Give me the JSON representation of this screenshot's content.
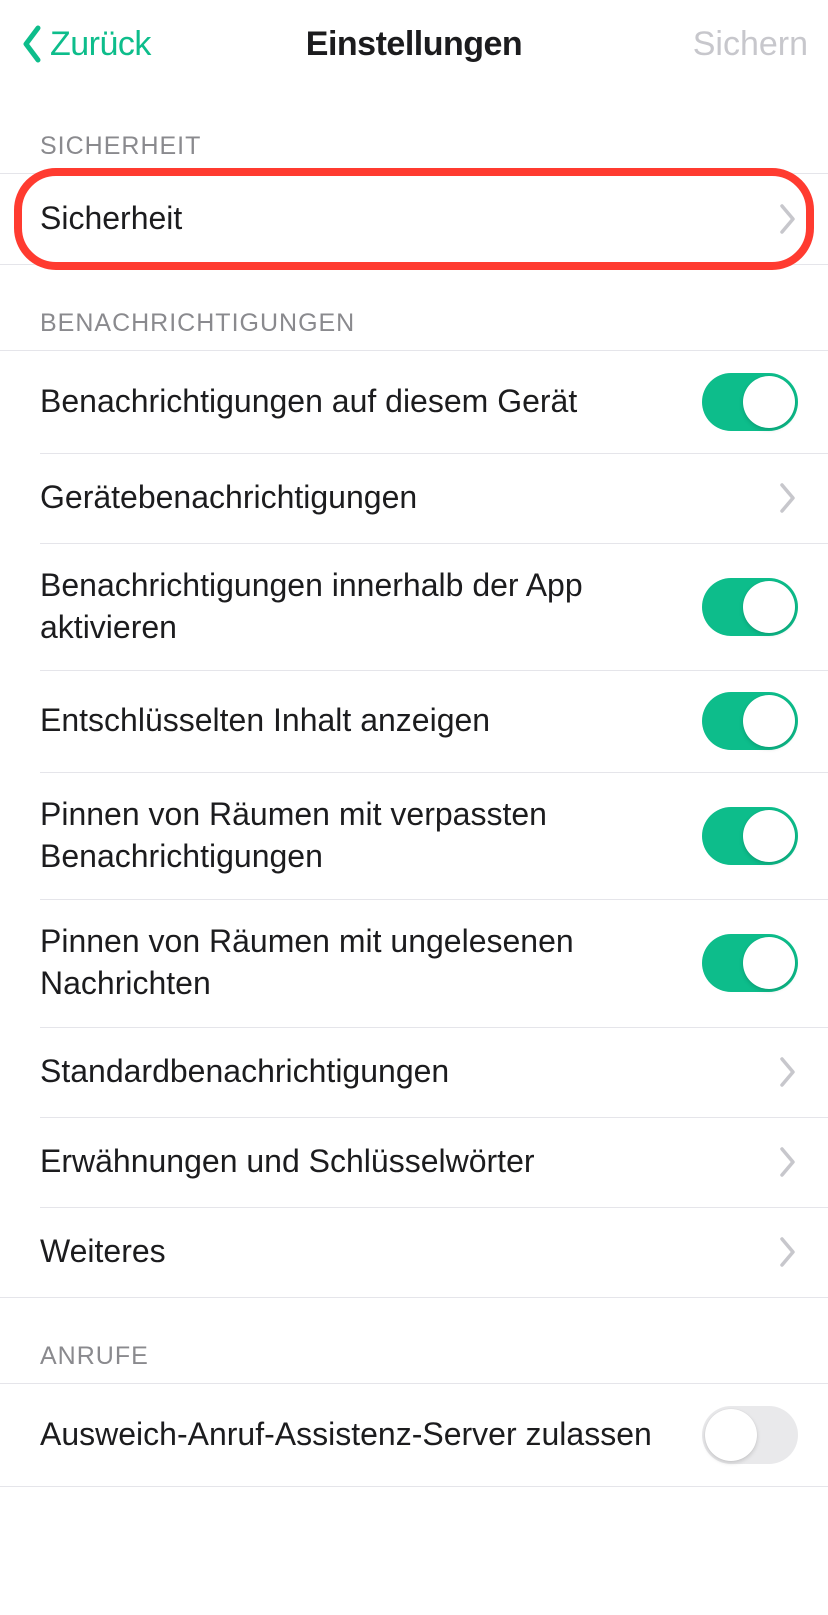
{
  "nav": {
    "back_label": "Zurück",
    "title": "Einstellungen",
    "action_label": "Sichern"
  },
  "sections": {
    "security": {
      "header": "SICHERHEIT",
      "items": [
        {
          "label": "Sicherheit",
          "type": "disclosure",
          "highlighted": true
        }
      ]
    },
    "notifications": {
      "header": "BENACHRICHTIGUNGEN",
      "items": [
        {
          "label": "Benachrichtigungen auf diesem Gerät",
          "type": "toggle",
          "value": true
        },
        {
          "label": "Gerätebenachrichtigungen",
          "type": "disclosure"
        },
        {
          "label": "Benachrichtigungen innerhalb der App aktivieren",
          "type": "toggle",
          "value": true
        },
        {
          "label": "Entschlüsselten Inhalt anzeigen",
          "type": "toggle",
          "value": true
        },
        {
          "label": "Pinnen von Räumen mit verpassten Benachrichtigungen",
          "type": "toggle",
          "value": true
        },
        {
          "label": "Pinnen von Räumen mit ungelesenen Nachrichten",
          "type": "toggle",
          "value": true
        },
        {
          "label": "Standardbenachrichtigungen",
          "type": "disclosure"
        },
        {
          "label": "Erwähnungen und Schlüsselwörter",
          "type": "disclosure"
        },
        {
          "label": "Weiteres",
          "type": "disclosure"
        }
      ]
    },
    "calls": {
      "header": "ANRUFE",
      "items": [
        {
          "label": "Ausweich-Anruf-Assistenz-Server zulassen",
          "type": "toggle",
          "value": false
        }
      ]
    }
  },
  "colors": {
    "accent": "#0dbd8b",
    "highlight": "#ff3b30"
  }
}
